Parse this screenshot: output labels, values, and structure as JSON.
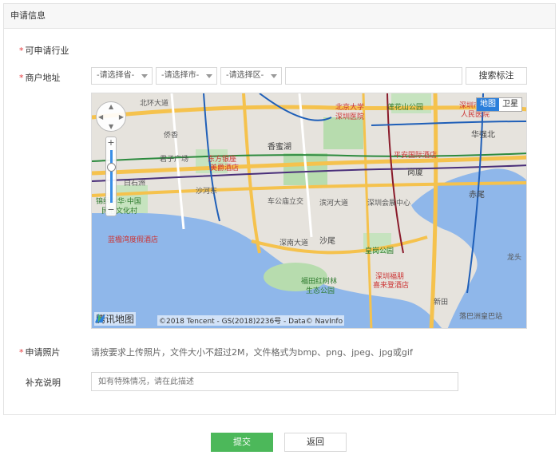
{
  "panel": {
    "title": "申请信息"
  },
  "form": {
    "industry_label": "可申请行业",
    "address_label": "商户地址",
    "photo_label": "申请照片",
    "remark_label": "补充说明",
    "required_mark": "*"
  },
  "address": {
    "province_placeholder": "-请选择省-",
    "city_placeholder": "-请选择市-",
    "district_placeholder": "-请选择区-",
    "input_value": "",
    "search_label": "搜索标注"
  },
  "map": {
    "type_map": "地图",
    "type_satellite": "卫星",
    "logo_text": "腾讯地图",
    "copyright": "©2018 Tencent - GS(2018)2236号 - Data© NavInfo",
    "zoom_in": "+",
    "zoom_out": "−",
    "labels": [
      "北京大学",
      "深圳医院",
      "莲花山公园",
      "深圳市",
      "人民医院",
      "华强北",
      "香蜜湖",
      "东方银座",
      "美爵酒店",
      "君子广场",
      "平安国际酒店",
      "岗厦",
      "锦绣中华·中国",
      "民俗文化村",
      "车公庙立交",
      "滨河大道",
      "深圳会展中心",
      "赤尾",
      "蓝楹湾度假酒店",
      "沙尾",
      "皇岗公园",
      "福田红树林",
      "生态公园",
      "深圳福朋",
      "喜来登酒店",
      "新田",
      "落巴洲皇巴站",
      "侨香",
      "白石洲",
      "沙河东",
      "深南大道",
      "北环大道",
      "龙头"
    ]
  },
  "photo": {
    "hint": "请按要求上传照片，文件大小不超过2M，文件格式为bmp、png、jpeg、jpg或gif"
  },
  "remark": {
    "placeholder": "如有特殊情况，请在此描述"
  },
  "actions": {
    "submit_label": "提交",
    "back_label": "返回"
  },
  "colors": {
    "accent": "#4cb85a",
    "required": "#e4393c",
    "map_active": "#2b7fdb"
  }
}
